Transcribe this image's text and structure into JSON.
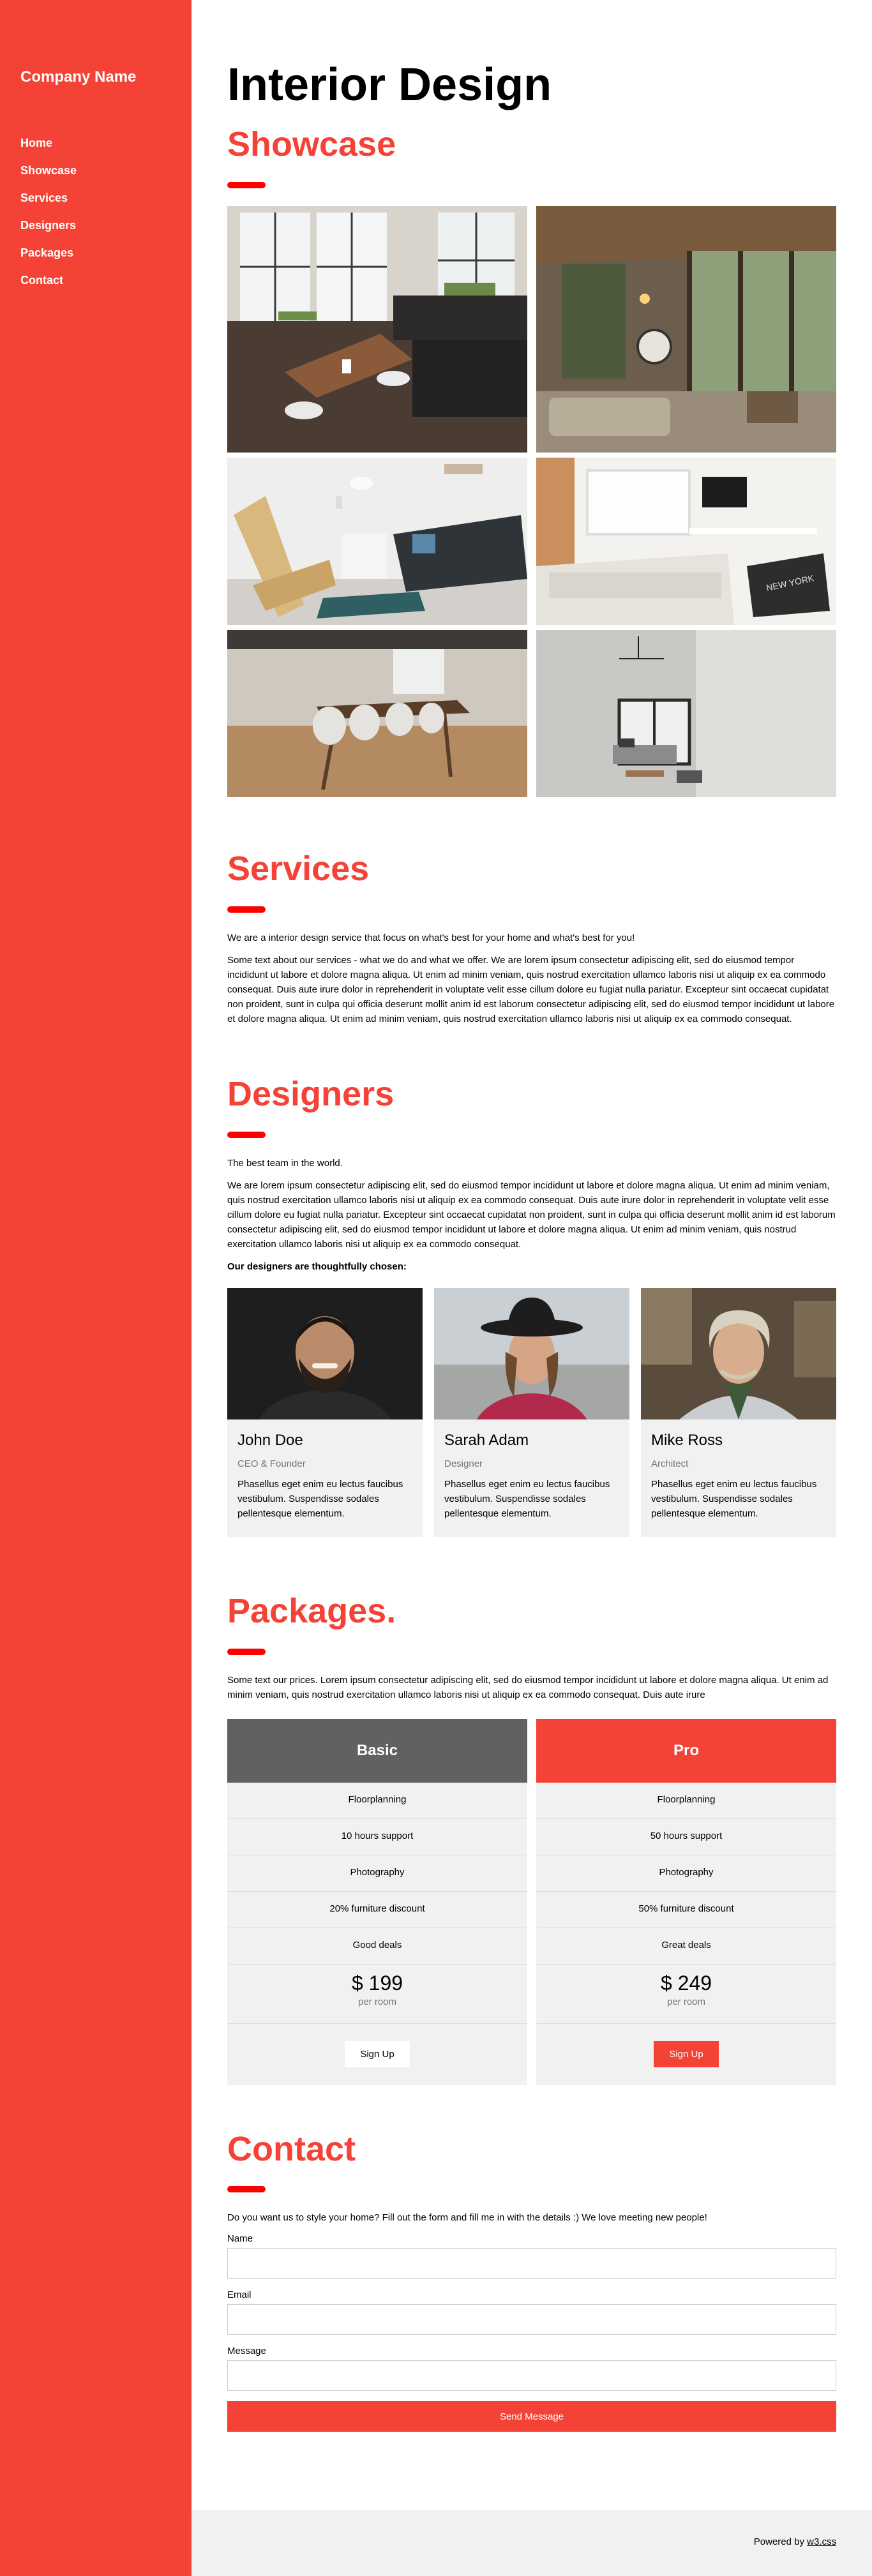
{
  "sidebar": {
    "brand": "Company Name",
    "nav": [
      "Home",
      "Showcase",
      "Services",
      "Designers",
      "Packages",
      "Contact"
    ]
  },
  "page_title": "Interior Design",
  "showcase": {
    "heading": "Showcase",
    "images": [
      "kitchen-dining-room",
      "living-room-view",
      "living-room-sofa",
      "bedroom-desk",
      "dining-table",
      "living-room-corner"
    ]
  },
  "services": {
    "heading": "Services",
    "intro": "We are a interior design service that focus on what's best for your home and what's best for you!",
    "body": "Some text about our services - what we do and what we offer. We are lorem ipsum consectetur adipiscing elit, sed do eiusmod tempor incididunt ut labore et dolore magna aliqua. Ut enim ad minim veniam, quis nostrud exercitation ullamco laboris nisi ut aliquip ex ea commodo consequat. Duis aute irure dolor in reprehenderit in voluptate velit esse cillum dolore eu fugiat nulla pariatur. Excepteur sint occaecat cupidatat non proident, sunt in culpa qui officia deserunt mollit anim id est laborum consectetur adipiscing elit, sed do eiusmod tempor incididunt ut labore et dolore magna aliqua. Ut enim ad minim veniam, quis nostrud exercitation ullamco laboris nisi ut aliquip ex ea commodo consequat."
  },
  "designers": {
    "heading": "Designers",
    "intro": "The best team in the world.",
    "body": "We are lorem ipsum consectetur adipiscing elit, sed do eiusmod tempor incididunt ut labore et dolore magna aliqua. Ut enim ad minim veniam, quis nostrud exercitation ullamco laboris nisi ut aliquip ex ea commodo consequat. Duis aute irure dolor in reprehenderit in voluptate velit esse cillum dolore eu fugiat nulla pariatur. Excepteur sint occaecat cupidatat non proident, sunt in culpa qui officia deserunt mollit anim id est laborum consectetur adipiscing elit, sed do eiusmod tempor incididunt ut labore et dolore magna aliqua. Ut enim ad minim veniam, quis nostrud exercitation ullamco laboris nisi ut aliquip ex ea commodo consequat.",
    "lead": "Our designers are thoughtfully chosen:",
    "team": [
      {
        "name": "John Doe",
        "role": "CEO & Founder",
        "desc": "Phasellus eget enim eu lectus faucibus vestibulum. Suspendisse sodales pellentesque elementum."
      },
      {
        "name": "Sarah Adam",
        "role": "Designer",
        "desc": "Phasellus eget enim eu lectus faucibus vestibulum. Suspendisse sodales pellentesque elementum."
      },
      {
        "name": "Mike Ross",
        "role": "Architect",
        "desc": "Phasellus eget enim eu lectus faucibus vestibulum. Suspendisse sodales pellentesque elementum."
      }
    ]
  },
  "packages": {
    "heading": "Packages.",
    "body": "Some text our prices. Lorem ipsum consectetur adipiscing elit, sed do eiusmod tempor incididunt ut labore et dolore magna aliqua. Ut enim ad minim veniam, quis nostrud exercitation ullamco laboris nisi ut aliquip ex ea commodo consequat. Duis aute irure",
    "plans": [
      {
        "name": "Basic",
        "features": [
          "Floorplanning",
          "10 hours support",
          "Photography",
          "20% furniture discount",
          "Good deals"
        ],
        "price": "$ 199",
        "per": "per room",
        "cta": "Sign Up"
      },
      {
        "name": "Pro",
        "features": [
          "Floorplanning",
          "50 hours support",
          "Photography",
          "50% furniture discount",
          "Great deals"
        ],
        "price": "$ 249",
        "per": "per room",
        "cta": "Sign Up"
      }
    ]
  },
  "contact": {
    "heading": "Contact",
    "intro": "Do you want us to style your home? Fill out the form and fill me in with the details :) We love meeting new people!",
    "name_label": "Name",
    "email_label": "Email",
    "message_label": "Message",
    "submit": "Send Message"
  },
  "footer": {
    "prefix": "Powered by ",
    "link": "w3.css"
  },
  "colors": {
    "accent": "#f44336",
    "basic_header": "#616161",
    "card_bg": "#f1f1f1"
  }
}
